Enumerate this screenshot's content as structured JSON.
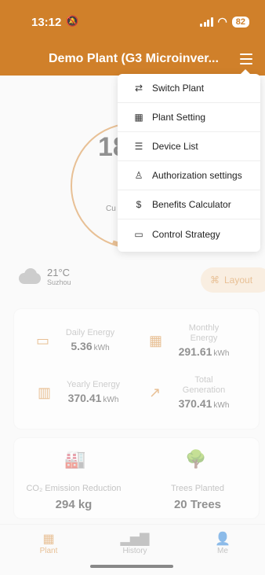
{
  "status_bar": {
    "time": "13:12",
    "battery": "82"
  },
  "header": {
    "title": "Demo Plant (G3 Microinver..."
  },
  "gauge": {
    "value": "18",
    "label": "Cu"
  },
  "weather": {
    "temperature": "21°C",
    "city": "Suzhou"
  },
  "layout_button": {
    "label": "Layout"
  },
  "energy": {
    "daily": {
      "label": "Daily Energy",
      "value": "5.36",
      "unit": "kWh"
    },
    "monthly": {
      "label": "Monthly Energy",
      "value": "291.61",
      "unit": "kWh"
    },
    "yearly": {
      "label": "Yearly Energy",
      "value": "370.41",
      "unit": "kWh"
    },
    "total": {
      "label": "Total Generation",
      "value": "370.41",
      "unit": "kWh"
    }
  },
  "environment": {
    "co2": {
      "label": "CO₂ Emission Reduction",
      "value": "294 kg"
    },
    "trees": {
      "label": "Trees Planted",
      "value": "20 Trees"
    }
  },
  "menu": {
    "items": [
      {
        "label": "Switch Plant",
        "icon": "switch-icon"
      },
      {
        "label": "Plant Setting",
        "icon": "grid-settings-icon"
      },
      {
        "label": "Device List",
        "icon": "checklist-icon"
      },
      {
        "label": "Authorization settings",
        "icon": "user-icon"
      },
      {
        "label": "Benefits Calculator",
        "icon": "money-bag-icon"
      },
      {
        "label": "Control Strategy",
        "icon": "toggle-icon"
      }
    ]
  },
  "tabs": [
    {
      "label": "Plant",
      "active": true
    },
    {
      "label": "History",
      "active": false
    },
    {
      "label": "Me",
      "active": false
    }
  ],
  "colors": {
    "accent": "#d0802a"
  }
}
